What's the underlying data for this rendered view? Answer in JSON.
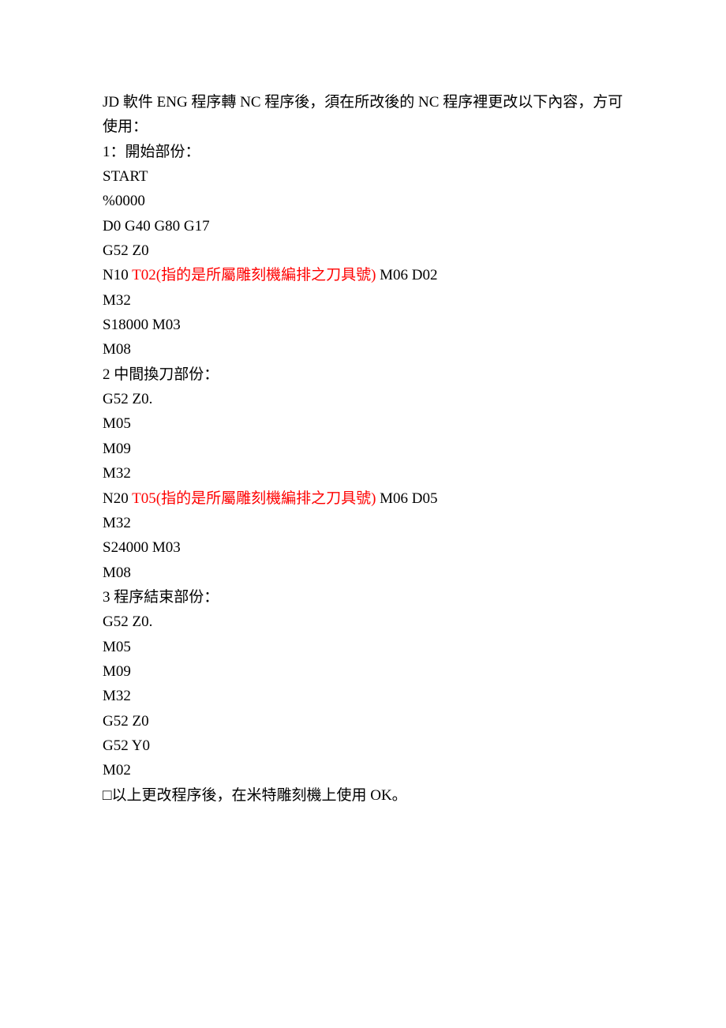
{
  "doc": {
    "intro": "JD 軟件 ENG 程序轉 NC 程序後，須在所改後的 NC 程序裡更改以下內容，方可使用：",
    "section1_title": "1：開始部份：",
    "s1_l1": "START",
    "s1_l2": "%0000",
    "s1_l3": "D0 G40 G80 G17",
    "s1_l4": "G52 Z0",
    "s1_l5_a": "N10 ",
    "s1_l5_red": "T02(指的是所屬雕刻機編排之刀具號)",
    "s1_l5_b": " M06 D02",
    "s1_l6": "M32",
    "s1_l7": "S18000 M03",
    "s1_l8": "M08",
    "section2_title": "2 中間換刀部份：",
    "s2_l1": "G52 Z0.",
    "s2_l2": "M05",
    "s2_l3": "M09",
    "s2_l4": "M32",
    "s2_l5_a": "N20 ",
    "s2_l5_red": "T05(指的是所屬雕刻機編排之刀具號)",
    "s2_l5_b": " M06 D05",
    "s2_l6": "M32",
    "s2_l7": "S24000 M03",
    "s2_l8": "M08",
    "section3_title": "3 程序結束部份：",
    "s3_l1": "G52 Z0.",
    "s3_l2": "M05",
    "s3_l3": "M09",
    "s3_l4": "M32",
    "s3_l5": "G52 Z0",
    "s3_l6": "G52 Y0",
    "s3_l7": "M02",
    "footer": "□以上更改程序後，在米特雕刻機上使用 OK。"
  }
}
